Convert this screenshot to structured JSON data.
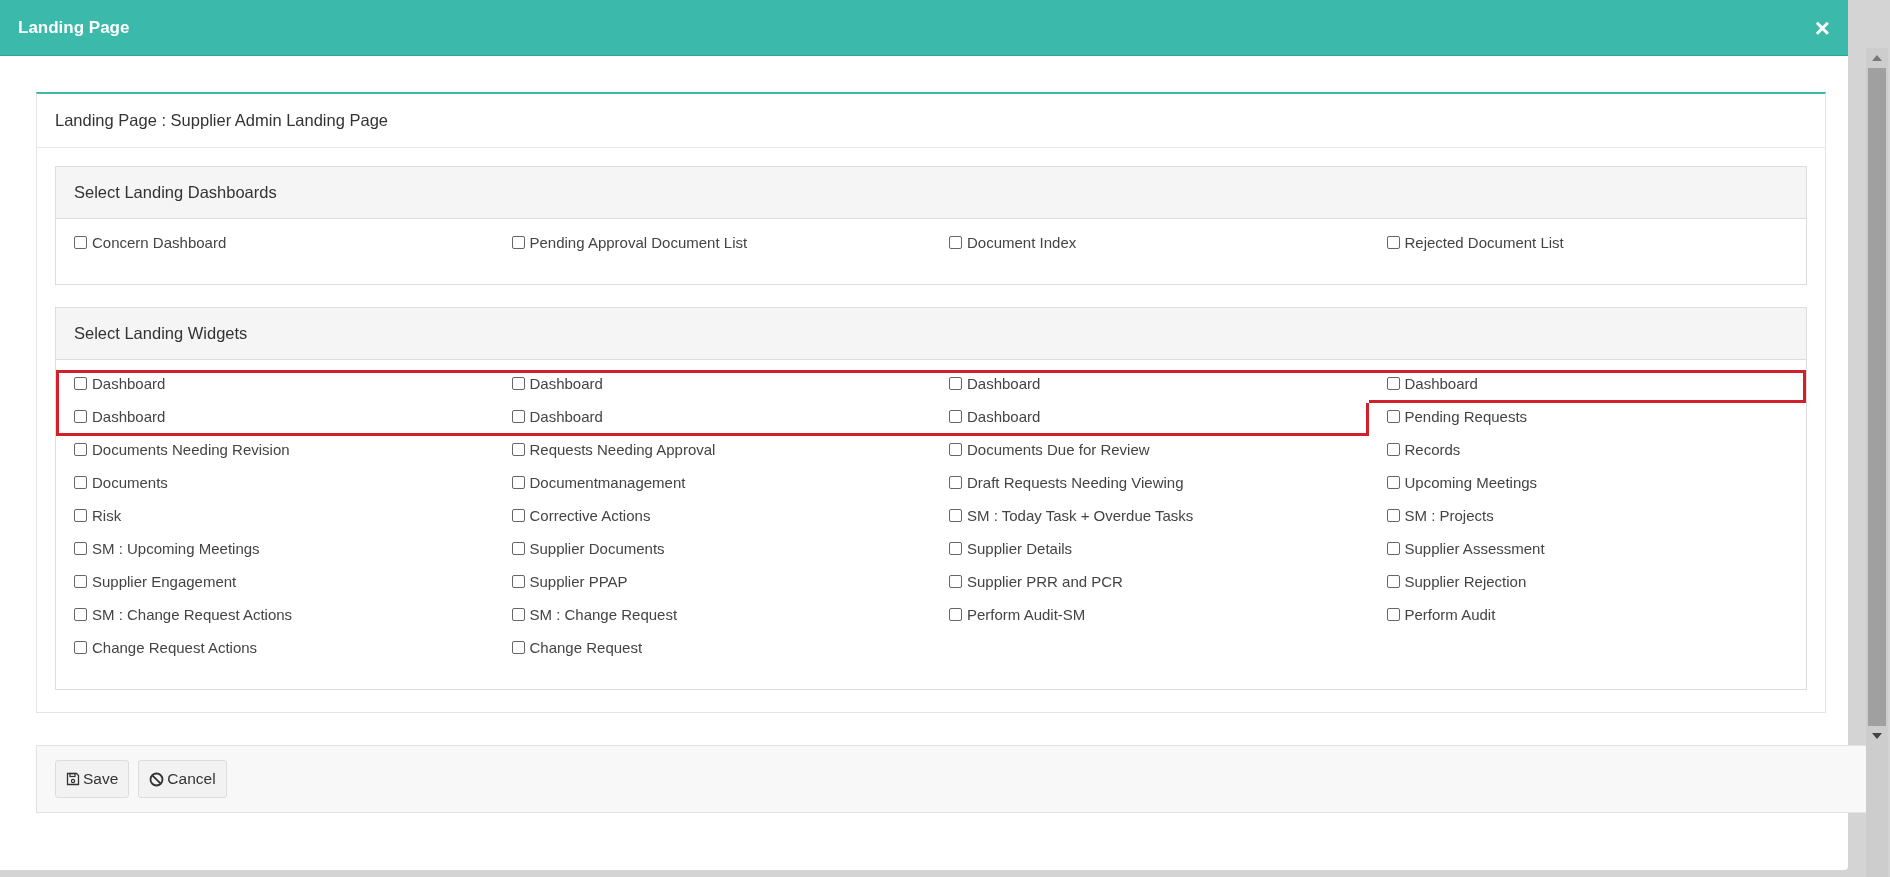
{
  "window": {
    "title": "Landing Page",
    "close": "×"
  },
  "panel": {
    "title": "Landing Page : Supplier Admin Landing Page"
  },
  "sections": [
    {
      "title": "Select Landing Dashboards",
      "items": [
        {
          "label": "Concern Dashboard",
          "checked": false,
          "highlighted": false
        },
        {
          "label": "Pending Approval Document List",
          "checked": false,
          "highlighted": false
        },
        {
          "label": "Document Index",
          "checked": false,
          "highlighted": false
        },
        {
          "label": "Rejected Document List",
          "checked": false,
          "highlighted": false
        }
      ]
    },
    {
      "title": "Select Landing Widgets",
      "items": [
        {
          "label": "Dashboard",
          "checked": false,
          "highlighted": true
        },
        {
          "label": "Dashboard",
          "checked": false,
          "highlighted": true
        },
        {
          "label": "Dashboard",
          "checked": false,
          "highlighted": true
        },
        {
          "label": "Dashboard",
          "checked": false,
          "highlighted": true
        },
        {
          "label": "Dashboard",
          "checked": false,
          "highlighted": true
        },
        {
          "label": "Dashboard",
          "checked": false,
          "highlighted": true
        },
        {
          "label": "Dashboard",
          "checked": false,
          "highlighted": true
        },
        {
          "label": "Pending Requests",
          "checked": false,
          "highlighted": false
        },
        {
          "label": "Documents Needing Revision",
          "checked": false,
          "highlighted": false
        },
        {
          "label": "Requests Needing Approval",
          "checked": false,
          "highlighted": false
        },
        {
          "label": "Documents Due for Review",
          "checked": false,
          "highlighted": false
        },
        {
          "label": "Records",
          "checked": false,
          "highlighted": false
        },
        {
          "label": "Documents",
          "checked": false,
          "highlighted": false
        },
        {
          "label": "Documentmanagement",
          "checked": false,
          "highlighted": false
        },
        {
          "label": "Draft Requests Needing Viewing",
          "checked": false,
          "highlighted": false
        },
        {
          "label": "Upcoming Meetings",
          "checked": false,
          "highlighted": false
        },
        {
          "label": "Risk",
          "checked": false,
          "highlighted": false
        },
        {
          "label": "Corrective Actions",
          "checked": false,
          "highlighted": false
        },
        {
          "label": "SM : Today Task + Overdue Tasks",
          "checked": false,
          "highlighted": false
        },
        {
          "label": "SM : Projects",
          "checked": false,
          "highlighted": false
        },
        {
          "label": "SM : Upcoming Meetings",
          "checked": false,
          "highlighted": false
        },
        {
          "label": "Supplier Documents",
          "checked": false,
          "highlighted": false
        },
        {
          "label": "Supplier Details",
          "checked": false,
          "highlighted": false
        },
        {
          "label": "Supplier Assessment",
          "checked": false,
          "highlighted": false
        },
        {
          "label": "Supplier Engagement",
          "checked": false,
          "highlighted": false
        },
        {
          "label": "Supplier PPAP",
          "checked": false,
          "highlighted": false
        },
        {
          "label": "Supplier PRR and PCR",
          "checked": false,
          "highlighted": false
        },
        {
          "label": "Supplier Rejection",
          "checked": false,
          "highlighted": false
        },
        {
          "label": "SM : Change Request Actions",
          "checked": false,
          "highlighted": false
        },
        {
          "label": "SM : Change Request",
          "checked": false,
          "highlighted": false
        },
        {
          "label": "Perform Audit-SM",
          "checked": false,
          "highlighted": false
        },
        {
          "label": "Perform Audit",
          "checked": false,
          "highlighted": false
        },
        {
          "label": "Change Request Actions",
          "checked": false,
          "highlighted": false
        },
        {
          "label": "Change Request",
          "checked": false,
          "highlighted": false
        }
      ]
    }
  ],
  "buttons": [
    {
      "kind": "save",
      "label": "Save"
    },
    {
      "kind": "cancel",
      "label": "Cancel"
    }
  ]
}
